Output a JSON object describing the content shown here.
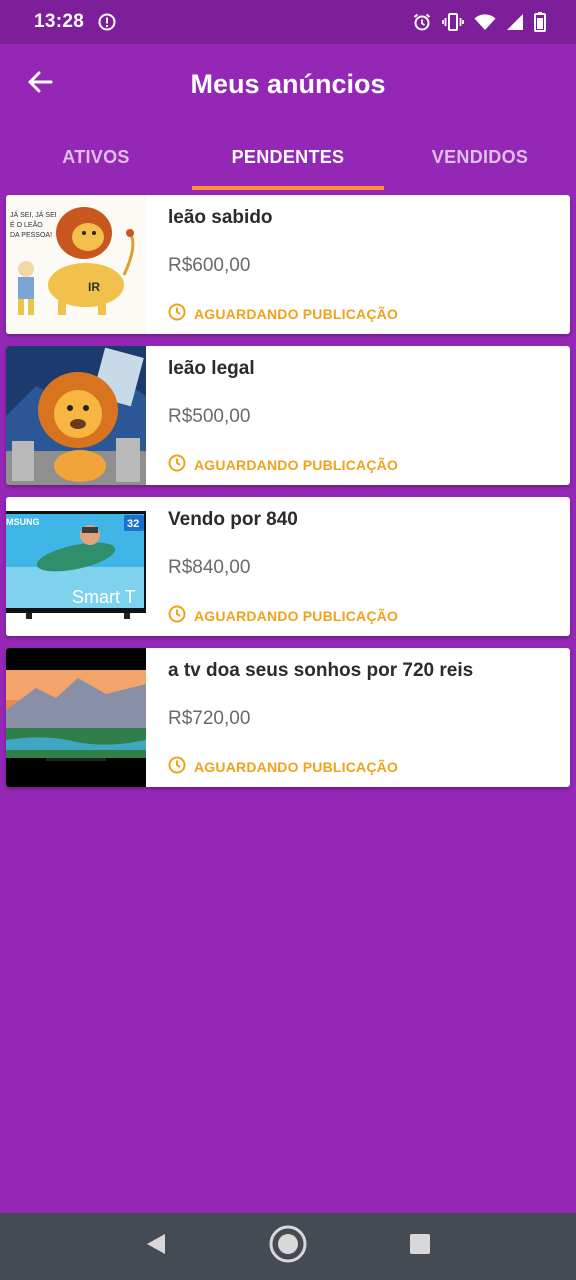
{
  "status_bar": {
    "time": "13:28",
    "icons": [
      "shield-alert-icon",
      "alarm-icon",
      "vibrate-icon",
      "wifi-icon",
      "signal-icon",
      "battery-icon"
    ]
  },
  "app_bar": {
    "title": "Meus anúncios",
    "back_icon": "arrow-back-icon"
  },
  "tabs": [
    {
      "label": "ATIVOS",
      "active": false
    },
    {
      "label": "PENDENTES",
      "active": true
    },
    {
      "label": "VENDIDOS",
      "active": false
    }
  ],
  "listings": [
    {
      "title": "leão sabido",
      "price": "R$600,00",
      "status": "AGUARDANDO PUBLICAÇÃO",
      "image": "lion-cartoon-ir"
    },
    {
      "title": "leão legal",
      "price": "R$500,00",
      "status": "AGUARDANDO PUBLICAÇÃO",
      "image": "lion-coins"
    },
    {
      "title": "Vendo por 840",
      "price": "R$840,00",
      "status": "AGUARDANDO PUBLICAÇÃO",
      "image": "samsung-smart-tv"
    },
    {
      "title": "a tv doa seus sonhos por 720 reis",
      "price": "R$720,00",
      "status": "AGUARDANDO PUBLICAÇÃO",
      "image": "tv-landscape"
    }
  ],
  "nav_bar": {
    "icons": [
      "back-triangle-icon",
      "home-circle-icon",
      "recents-square-icon"
    ]
  },
  "colors": {
    "background": "#9427b5",
    "status_bar": "#7e1f9a",
    "tab_indicator": "#ff8f3a",
    "status_text": "#f1a21a",
    "nav_bar": "#454b52"
  }
}
